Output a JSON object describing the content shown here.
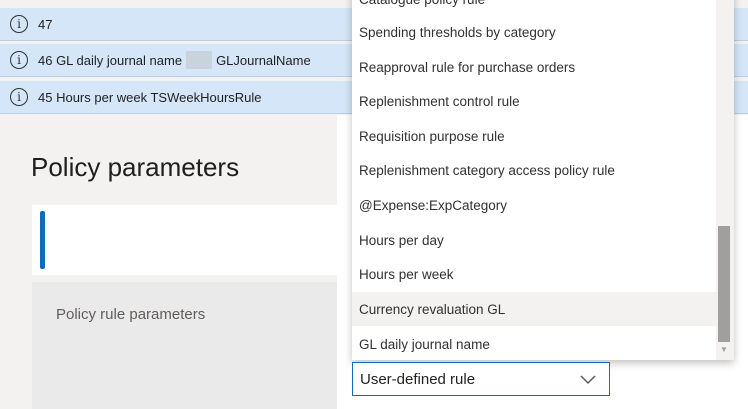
{
  "messages": [
    {
      "text": "47"
    },
    {
      "text_before": "46 GL daily journal name",
      "text_after": "GLJournalName"
    },
    {
      "text": "45 Hours per week TSWeekHoursRule"
    }
  ],
  "page": {
    "title": "Policy parameters"
  },
  "policy_panel": {
    "label": "Policy rule parameters"
  },
  "dropdown": {
    "items": [
      "Catalogue policy rule",
      "Spending thresholds by category",
      "Reapproval rule for purchase orders",
      "Replenishment control rule",
      "Requisition purpose rule",
      "Replenishment category access policy rule",
      "@Expense:ExpCategory",
      "Hours per day",
      "Hours per week",
      "Currency revaluation GL",
      "GL daily journal name"
    ],
    "hovered_item": "Currency revaluation GL"
  },
  "rule_select": {
    "value": "User-defined rule"
  },
  "icons": {
    "info": "info-icon",
    "chevron": "chevron-down-icon",
    "scroll_down": "scroll-down-arrow-icon"
  },
  "colors": {
    "accent": "#0f6cbd",
    "message_bar": "#d4e6f7"
  }
}
